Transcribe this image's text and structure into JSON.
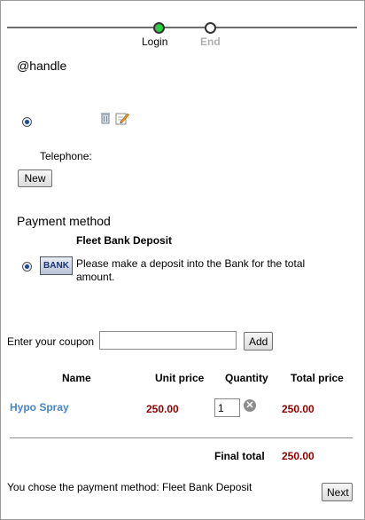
{
  "progress": {
    "steps": [
      {
        "label": "Login",
        "active": true
      },
      {
        "label": "End",
        "active": false
      }
    ]
  },
  "account": {
    "handle": "@handle",
    "telephone_label": "Telephone:",
    "new_button": "New"
  },
  "payment": {
    "section_title": "Payment method",
    "method_name": "Fleet Bank Deposit",
    "bank_logo_text": "BANK",
    "description": "Please make a deposit into the Bank for the total amount."
  },
  "coupon": {
    "label": "Enter your coupon",
    "value": "",
    "add_button": "Add"
  },
  "cart": {
    "headers": [
      "Name",
      "Unit price",
      "Quantity",
      "Total price"
    ],
    "items": [
      {
        "name": "Hypo Spray",
        "unit_price": "250.00",
        "quantity": "1",
        "total_price": "250.00"
      }
    ],
    "final_total_label": "Final total",
    "final_total": "250.00"
  },
  "footer": {
    "chosen_message": "You chose the payment method: Fleet Bank Deposit",
    "next_button": "Next"
  },
  "colors": {
    "active_step": "#2ecc40",
    "price": "#8b0000",
    "link": "#4a86c5"
  }
}
